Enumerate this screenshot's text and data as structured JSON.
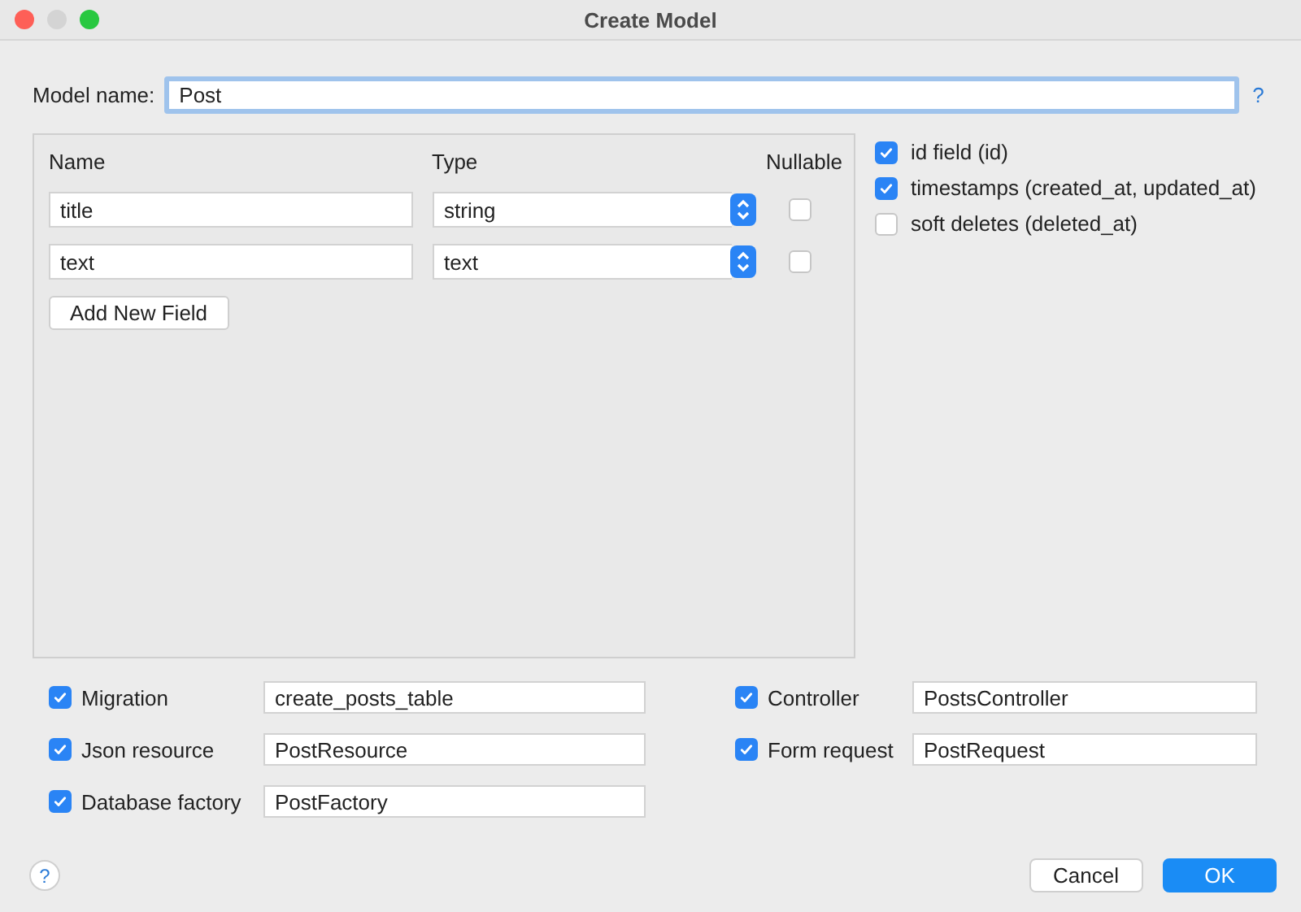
{
  "window": {
    "title": "Create Model",
    "controls": [
      {
        "kind": "close",
        "disabled": false
      },
      {
        "kind": "minimize",
        "disabled": true
      },
      {
        "kind": "zoom",
        "disabled": false
      }
    ]
  },
  "model_name": {
    "label": "Model name:",
    "value": "Post",
    "help": "?"
  },
  "fields_table": {
    "columns": [
      "Name",
      "Type",
      "Nullable"
    ],
    "rows": [
      {
        "name": "title",
        "type": "string",
        "nullable": false
      },
      {
        "name": "text",
        "type": "text",
        "nullable": false
      }
    ],
    "add_button": "Add New Field"
  },
  "options": [
    {
      "label": "id field (id)",
      "checked": true
    },
    {
      "label": "timestamps (created_at, updated_at)",
      "checked": true
    },
    {
      "label": "soft deletes (deleted_at)",
      "checked": false
    }
  ],
  "generators": {
    "left": [
      {
        "label": "Migration",
        "checked": true,
        "value": "create_posts_table"
      },
      {
        "label": "Json resource",
        "checked": true,
        "value": "PostResource"
      },
      {
        "label": "Database factory",
        "checked": true,
        "value": "PostFactory"
      }
    ],
    "right": [
      {
        "label": "Controller",
        "checked": true,
        "value": "PostsController"
      },
      {
        "label": "Form request",
        "checked": true,
        "value": "PostRequest"
      }
    ]
  },
  "footer": {
    "help": "?",
    "buttons": [
      {
        "label": "Cancel",
        "kind": "secondary"
      },
      {
        "label": "OK",
        "kind": "primary"
      }
    ]
  }
}
